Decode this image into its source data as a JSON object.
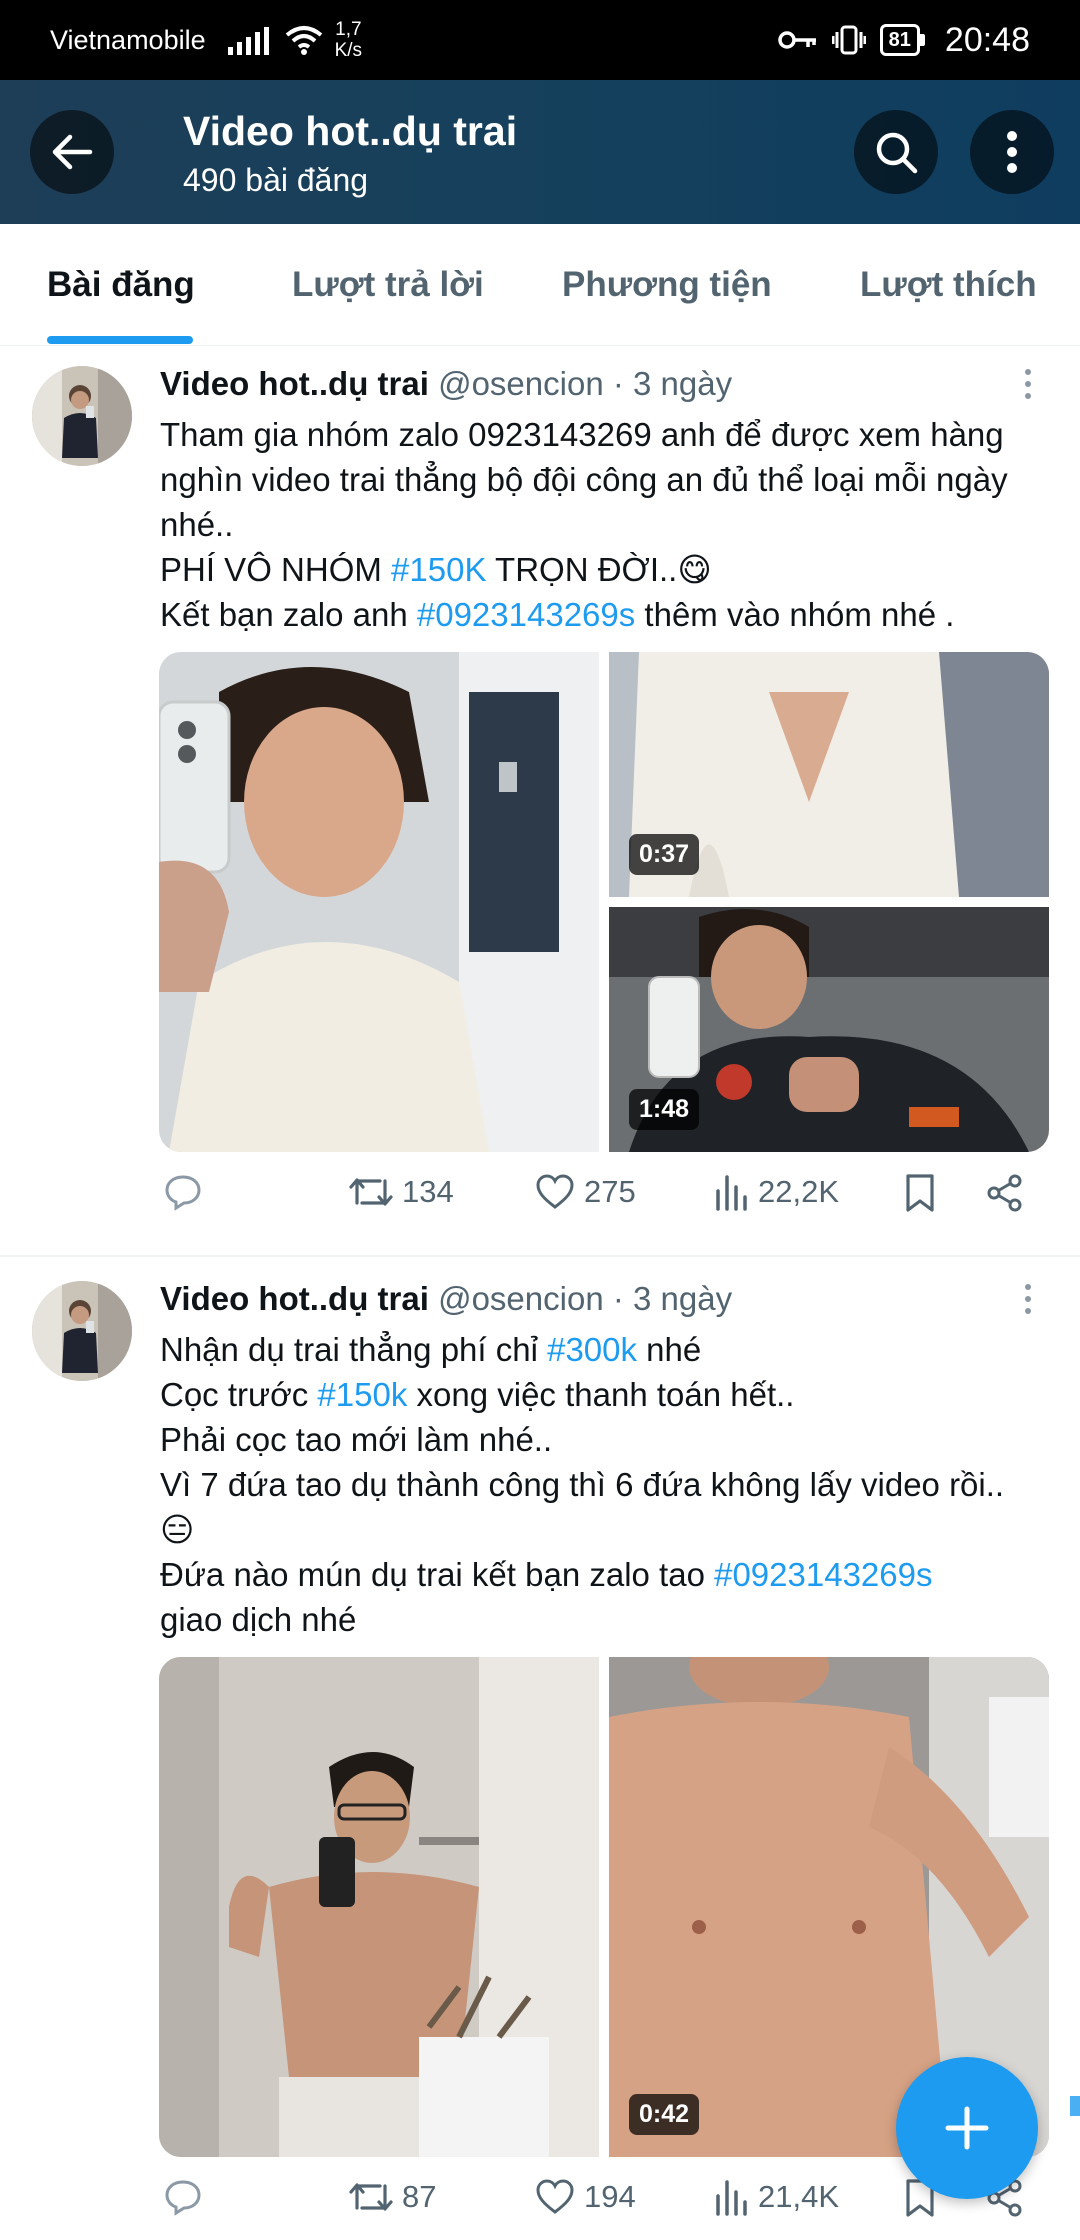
{
  "status_bar": {
    "carrier": "Vietnamobile",
    "speed_value": "1,7",
    "speed_unit": "K/s",
    "battery": "81",
    "time": "20:48"
  },
  "header": {
    "title": "Video hot..dụ trai",
    "post_count": "490 bài đăng",
    "icons": [
      "back-arrow-icon",
      "search-icon",
      "more-vertical-icon"
    ]
  },
  "tabs": [
    {
      "label": "Bài đăng",
      "active": true
    },
    {
      "label": "Lượt trả lời",
      "active": false
    },
    {
      "label": "Phương tiện",
      "active": false
    },
    {
      "label": "Lượt thích",
      "active": false
    }
  ],
  "posts": [
    {
      "name": "Video hot..dụ trai",
      "handle": "@osencion",
      "time": "· 3 ngày",
      "lines": {
        "l1": "Tham gia nhóm zalo  0923143269 anh để được xem hàng nghìn video trai thẳng bộ đội công an đủ thể loại mỗi ngày nhé..",
        "l2a": "PHÍ VÔ NHÓM ",
        "l2tag": "#150K",
        "l2b": " TRỌN ĐỜI..",
        "l2emoji": "😋",
        "l3a": "Kết bạn zalo anh ",
        "l3tag": "#0923143269s",
        "l3b": " thêm vào nhóm nhé ."
      },
      "media_durations": [
        "0:37",
        "1:48"
      ],
      "stats": {
        "retweets": "134",
        "likes": "275",
        "views": "22,2K"
      }
    },
    {
      "name": "Video hot..dụ trai",
      "handle": "@osencion",
      "time": "· 3 ngày",
      "lines": {
        "l1a": "Nhận dụ trai thẳng phí chỉ ",
        "l1tag": "#300k",
        "l1b": " nhé",
        "l2a": "Cọc trước ",
        "l2tag": "#150k",
        "l2b": " xong việc thanh toán hết..",
        "l3": "Phải cọc tao mới làm nhé..",
        "l4": "Vì 7 đứa tao dụ thành công thì 6 đứa không lấy video rồi..",
        "l4emoji": "😑",
        "l5a": "Đứa nào mún dụ trai kết bạn zalo tao ",
        "l5tag": "#0923143269s",
        "l5b": " giao dịch nhé"
      },
      "media_durations": [
        "0:42"
      ],
      "stats": {
        "retweets": "87",
        "likes": "194",
        "views": "21,4K"
      }
    }
  ],
  "colors": {
    "accent": "#1d9bf0",
    "header_bg": "#16405c",
    "muted_text": "#536471"
  }
}
